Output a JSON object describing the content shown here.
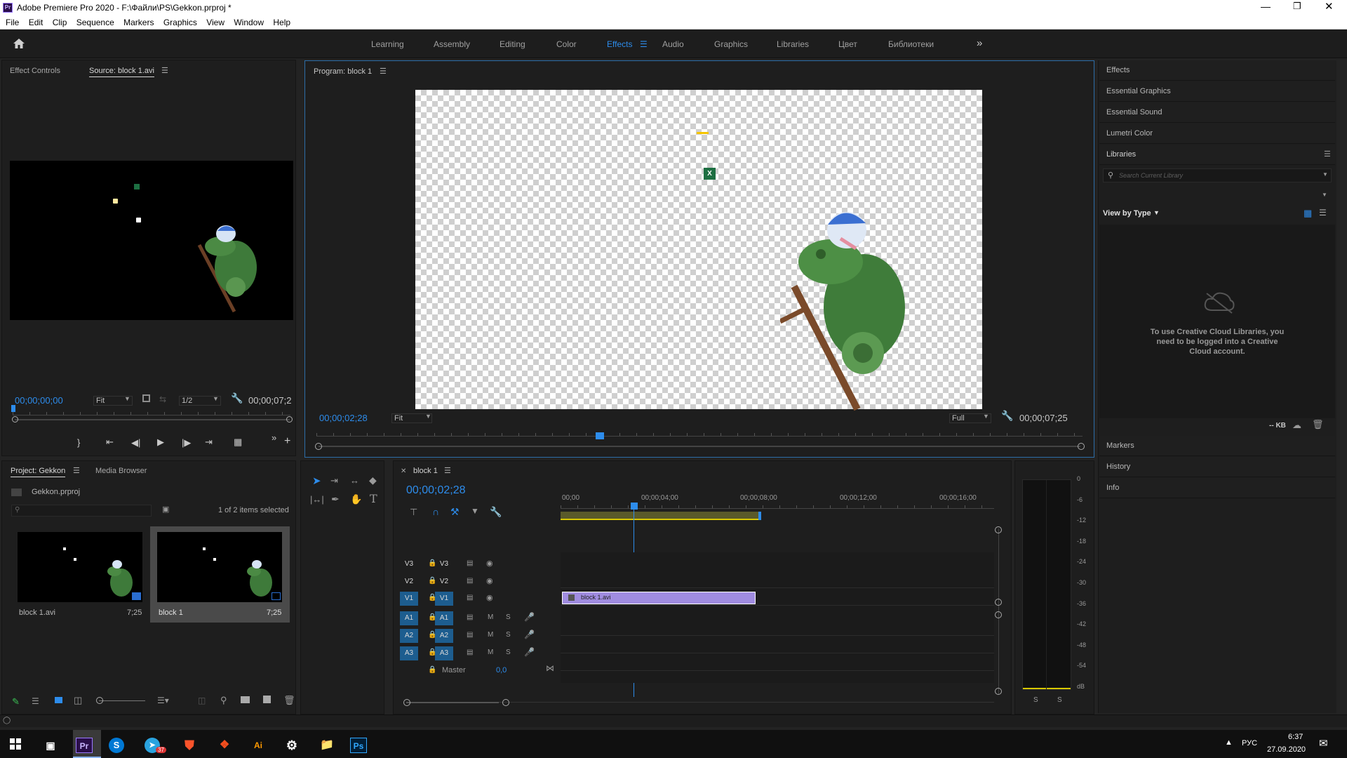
{
  "window": {
    "title": "Adobe Premiere Pro 2020 - F:\\Файли\\PS\\Gekkon.prproj *"
  },
  "menu": [
    "File",
    "Edit",
    "Clip",
    "Sequence",
    "Markers",
    "Graphics",
    "View",
    "Window",
    "Help"
  ],
  "workspaces": {
    "items": [
      "Learning",
      "Assembly",
      "Editing",
      "Color",
      "Effects",
      "Audio",
      "Graphics",
      "Libraries",
      "Цвет",
      "Библиотеки"
    ],
    "active": "Effects"
  },
  "source_panel": {
    "tabs": [
      "Effect Controls",
      "Source: block 1.avi"
    ],
    "timecode": "00;00;00;00",
    "fit": "Fit",
    "resolution": "1/2",
    "duration": "00;00;07;2"
  },
  "program_panel": {
    "tab": "Program: block 1",
    "timecode": "00;00;02;28",
    "fit": "Fit",
    "quality": "Full",
    "duration": "00;00;07;25",
    "playhead_fraction": 0.37
  },
  "right_panels": {
    "items": [
      "Effects",
      "Essential Graphics",
      "Essential Sound",
      "Lumetri Color",
      "Libraries"
    ],
    "search_placeholder": "Search Current Library",
    "view_by": "View by Type",
    "message": "To use Creative Cloud Libraries, you need to be logged into a Creative Cloud account.",
    "kb": "-- KB",
    "bottom_items": [
      "Markers",
      "History",
      "Info"
    ]
  },
  "project_panel": {
    "tabs": [
      "Project: Gekkon",
      "Media Browser"
    ],
    "project_file": "Gekkon.prproj",
    "selection": "1 of 2 items selected",
    "items": [
      {
        "name": "block 1.avi",
        "duration": "7;25"
      },
      {
        "name": "block 1",
        "duration": "7;25"
      }
    ]
  },
  "timeline": {
    "tab": "block 1",
    "timecode": "00;00;02;28",
    "ruler": [
      "00;00",
      "00;00;04;00",
      "00;00;08;00",
      "00;00;12;00",
      "00;00;16;00"
    ],
    "video_tracks": [
      "V3",
      "V2",
      "V1"
    ],
    "audio_tracks": [
      "A1",
      "A2",
      "A3"
    ],
    "master_label": "Master",
    "master_value": "0,0",
    "clip_name": "block 1.avi"
  },
  "audio_meter": {
    "scale": [
      "0",
      "-6",
      "-12",
      "-18",
      "-24",
      "-30",
      "-36",
      "-42",
      "-48",
      "-54",
      "dB"
    ],
    "solo": [
      "S",
      "S"
    ]
  },
  "taskbar": {
    "lang": "РУС",
    "time": "6:37",
    "date": "27.09.2020",
    "telegram_badge": "37"
  }
}
